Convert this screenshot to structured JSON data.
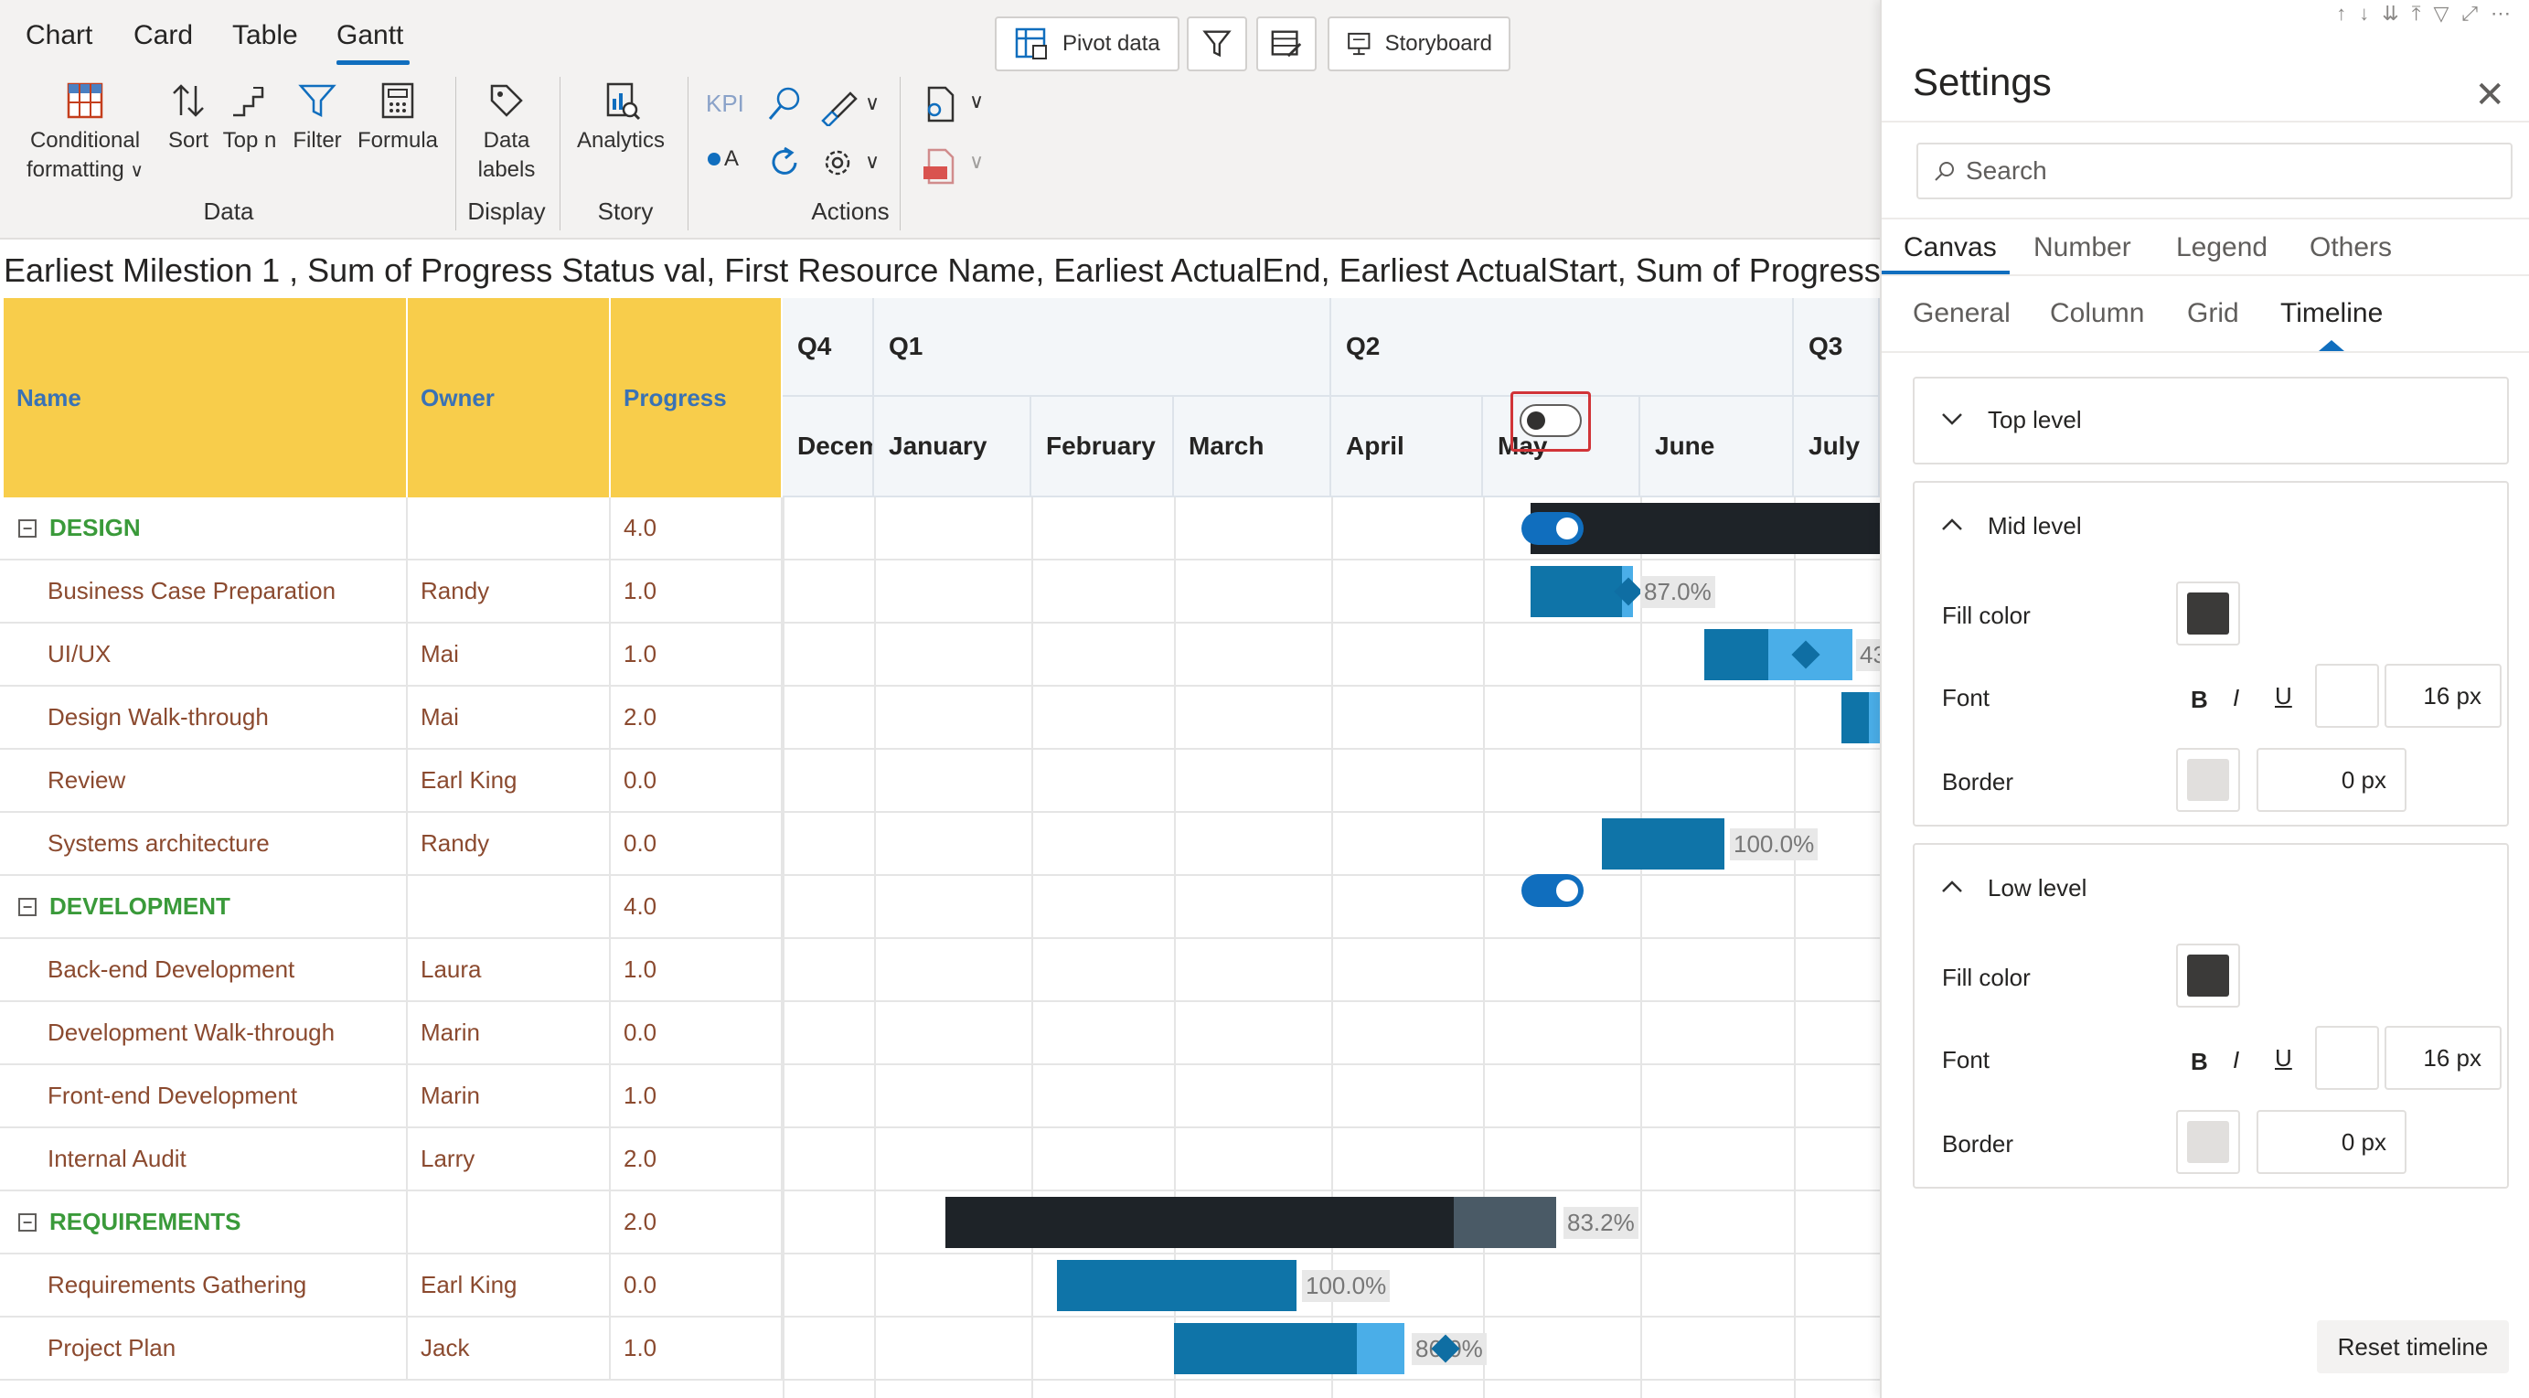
{
  "ribbon": {
    "tabs": [
      "Chart",
      "Card",
      "Table",
      "Gantt"
    ],
    "active_tab": "Gantt",
    "top_buttons": {
      "pivot": "Pivot data",
      "storyboard": "Storyboard"
    },
    "data_group": {
      "conditional_formatting": "Conditional",
      "conditional_formatting_2": "formatting",
      "sort": "Sort",
      "topn": "Top n",
      "filter": "Filter",
      "formula": "Formula",
      "label": "Data"
    },
    "display_group": {
      "data_labels": "Data",
      "data_labels_2": "labels",
      "label": "Display"
    },
    "story_group": {
      "analytics": "Analytics",
      "label": "Story"
    },
    "actions_group": {
      "kpi": "KPI",
      "oa": "A",
      "label": "Actions"
    }
  },
  "chart_title": "Earliest Milestion 1 , Sum of Progress Status val, First Resource Name, Earliest ActualEnd, Earliest ActualStart, Sum of Progress by T",
  "grid": {
    "headers": {
      "name": "Name",
      "owner": "Owner",
      "progress": "Progress"
    },
    "quarters": [
      "Q4",
      "Q1",
      "Q2",
      "Q3"
    ],
    "months": [
      "Decem",
      "January",
      "February",
      "March",
      "April",
      "May",
      "June",
      "July"
    ],
    "rows": [
      {
        "name": "DESIGN",
        "owner": "",
        "progress": "4.0",
        "group": true
      },
      {
        "name": "Business Case Preparation",
        "owner": "Randy",
        "progress": "1.0"
      },
      {
        "name": "UI/UX",
        "owner": "Mai",
        "progress": "1.0"
      },
      {
        "name": "Design Walk-through",
        "owner": "Mai",
        "progress": "2.0"
      },
      {
        "name": "Review",
        "owner": "Earl King",
        "progress": "0.0"
      },
      {
        "name": "Systems architecture",
        "owner": "Randy",
        "progress": "0.0"
      },
      {
        "name": "DEVELOPMENT",
        "owner": "",
        "progress": "4.0",
        "group": true
      },
      {
        "name": "Back-end Development",
        "owner": "Laura",
        "progress": "1.0"
      },
      {
        "name": "Development Walk-through",
        "owner": "Marin",
        "progress": "0.0"
      },
      {
        "name": "Front-end Development",
        "owner": "Marin",
        "progress": "1.0"
      },
      {
        "name": "Internal Audit",
        "owner": "Larry",
        "progress": "2.0"
      },
      {
        "name": "REQUIREMENTS",
        "owner": "",
        "progress": "2.0",
        "group": true
      },
      {
        "name": "Requirements Gathering",
        "owner": "Earl King",
        "progress": "0.0"
      },
      {
        "name": "Project Plan",
        "owner": "Jack",
        "progress": "1.0"
      }
    ],
    "bar_labels": {
      "business_case": "87.0%",
      "uiux": "43",
      "systems": "100.0%",
      "requirements": "83.2%",
      "req_gathering": "100.0%",
      "project_plan": "86.0%"
    },
    "colors": {
      "header_fill": "#f8cd4b",
      "header_text": "#3a72b5",
      "group_text": "#3a9a3a",
      "task_text": "#8b4a2f",
      "summary_bar": "#1e2328",
      "summary_remaining": "#4a5a66",
      "task_bar": "#0f74a8",
      "task_remaining": "#4aaee8",
      "milestone": "#0f6ea3"
    }
  },
  "settings": {
    "title": "Settings",
    "search_placeholder": "Search",
    "primary_tabs": [
      "Canvas",
      "Number",
      "Legend",
      "Others"
    ],
    "active_primary_tab": "Canvas",
    "secondary_tabs": [
      "General",
      "Column",
      "Grid",
      "Timeline"
    ],
    "active_secondary_tab": "Timeline",
    "top_level": {
      "label": "Top level",
      "enabled": false
    },
    "mid_level": {
      "label": "Mid level",
      "enabled": true,
      "fill_label": "Fill color",
      "fill_color": "#3b3a39",
      "font_label": "Font",
      "bold": "B",
      "italic": "I",
      "underline": "U",
      "font_size": "16 px",
      "border_label": "Border",
      "border_color": "#e1dfdd",
      "border_size": "0 px"
    },
    "low_level": {
      "label": "Low level",
      "enabled": true,
      "fill_label": "Fill color",
      "fill_color": "#3b3a39",
      "font_label": "Font",
      "bold": "B",
      "italic": "I",
      "underline": "U",
      "font_size": "16 px",
      "border_label": "Border",
      "border_color": "#e1dfdd",
      "border_size": "0 px"
    },
    "reset_label": "Reset timeline"
  }
}
